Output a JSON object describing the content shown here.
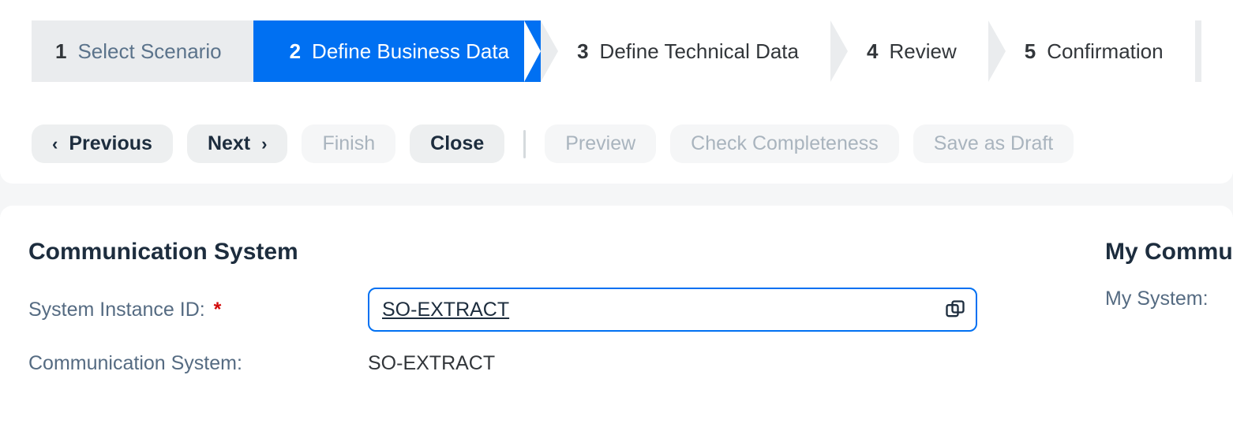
{
  "wizard": {
    "steps": [
      {
        "num": "1",
        "label": "Select Scenario"
      },
      {
        "num": "2",
        "label": "Define Business Data"
      },
      {
        "num": "3",
        "label": "Define Technical Data"
      },
      {
        "num": "4",
        "label": "Review"
      },
      {
        "num": "5",
        "label": "Confirmation"
      }
    ]
  },
  "toolbar": {
    "previous": "Previous",
    "next": "Next",
    "finish": "Finish",
    "close": "Close",
    "preview": "Preview",
    "check": "Check Completeness",
    "save_draft": "Save as Draft"
  },
  "section_left": {
    "title": "Communication System",
    "system_instance_id_label": "System Instance ID:",
    "system_instance_id_value": "SO-EXTRACT",
    "communication_system_label": "Communication System:",
    "communication_system_value": "SO-EXTRACT"
  },
  "section_right": {
    "title": "My Communication",
    "my_system_label": "My System:"
  }
}
